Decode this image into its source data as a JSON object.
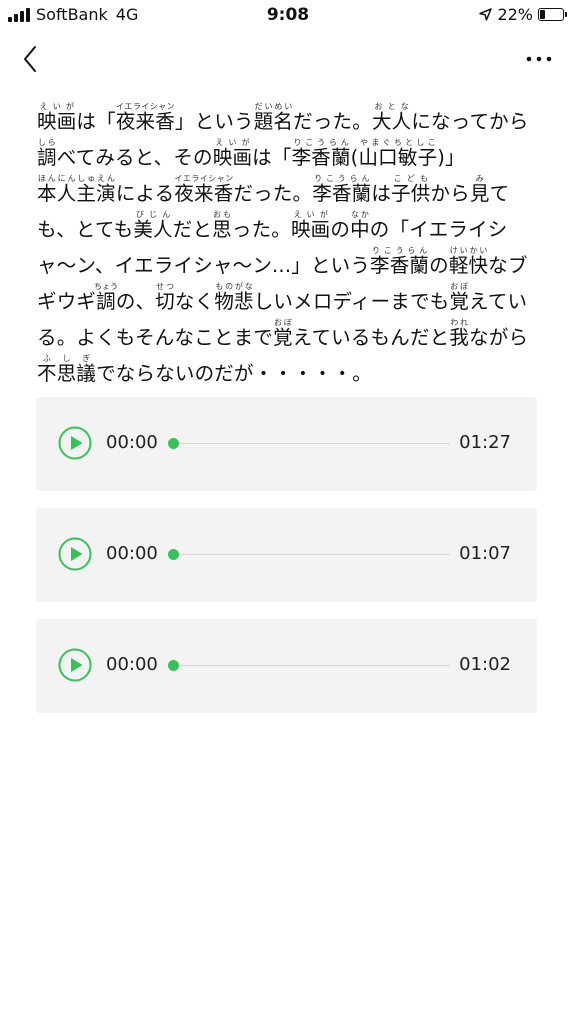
{
  "status_bar": {
    "carrier": "SoftBank",
    "network": "4G",
    "time": "9:08",
    "battery_text": "22%",
    "battery_level": 0.22
  },
  "nav": {
    "back_icon": "chevron-left-icon",
    "more_icon": "ellipsis-icon"
  },
  "article": {
    "paragraph": [
      {
        "t": "映画",
        "r": "えいが"
      },
      {
        "t": "は「"
      },
      {
        "t": "夜来香",
        "r": "イエライシャン"
      },
      {
        "t": "」という"
      },
      {
        "t": "題名",
        "r": "だいめい"
      },
      {
        "t": "だった。"
      },
      {
        "t": "大人",
        "r": "おとな"
      },
      {
        "t": "になってから"
      },
      {
        "t": "調",
        "r": "しら"
      },
      {
        "t": "べてみると、その"
      },
      {
        "t": "映画",
        "r": "えいが"
      },
      {
        "t": "は「"
      },
      {
        "t": "李香蘭",
        "r": "りこうらん"
      },
      {
        "t": "("
      },
      {
        "t": "山口敏子",
        "r": "やまぐちとしこ"
      },
      {
        "t": ")」"
      },
      {
        "t": "本人主演",
        "r": "ほんにんしゅえん"
      },
      {
        "t": "による"
      },
      {
        "t": "夜来香",
        "r": "イエライシャン"
      },
      {
        "t": "だった。"
      },
      {
        "t": "李香蘭",
        "r": "りこうらん"
      },
      {
        "t": "は"
      },
      {
        "t": "子供",
        "r": "こども"
      },
      {
        "t": "から"
      },
      {
        "t": "見",
        "r": "み"
      },
      {
        "t": "ても、とても"
      },
      {
        "t": "美人",
        "r": "びじん"
      },
      {
        "t": "だと"
      },
      {
        "t": "思",
        "r": "おも"
      },
      {
        "t": "った。"
      },
      {
        "t": "映画",
        "r": "えいが"
      },
      {
        "t": "の"
      },
      {
        "t": "中",
        "r": "なか"
      },
      {
        "t": "の「イエライシャ〜ン、イエライシャ〜ン...」という"
      },
      {
        "t": "李香蘭",
        "r": "りこうらん"
      },
      {
        "t": "の"
      },
      {
        "t": "軽快",
        "r": "けいかい"
      },
      {
        "t": "なブギウギ"
      },
      {
        "t": "調",
        "r": "ちょう"
      },
      {
        "t": "の、"
      },
      {
        "t": "切",
        "r": "せつ"
      },
      {
        "t": "なく"
      },
      {
        "t": "物悲",
        "r": "ものがな"
      },
      {
        "t": "しいメロディーまでも"
      },
      {
        "t": "覚",
        "r": "おぼ"
      },
      {
        "t": "えている。よくもそんなことまで"
      },
      {
        "t": "覚",
        "r": "おぼ"
      },
      {
        "t": "えているもんだと"
      },
      {
        "t": "我",
        "r": "われ"
      },
      {
        "t": "ながら"
      },
      {
        "t": "不思議",
        "r": "ふしぎ"
      },
      {
        "t": "でならないのだが・・・・・。"
      }
    ]
  },
  "players": [
    {
      "current": "00:00",
      "duration": "01:27",
      "progress": 0
    },
    {
      "current": "00:00",
      "duration": "01:07",
      "progress": 0
    },
    {
      "current": "00:00",
      "duration": "01:02",
      "progress": 0
    }
  ],
  "colors": {
    "accent": "#37c259",
    "player_bg": "#f3f3f3"
  }
}
